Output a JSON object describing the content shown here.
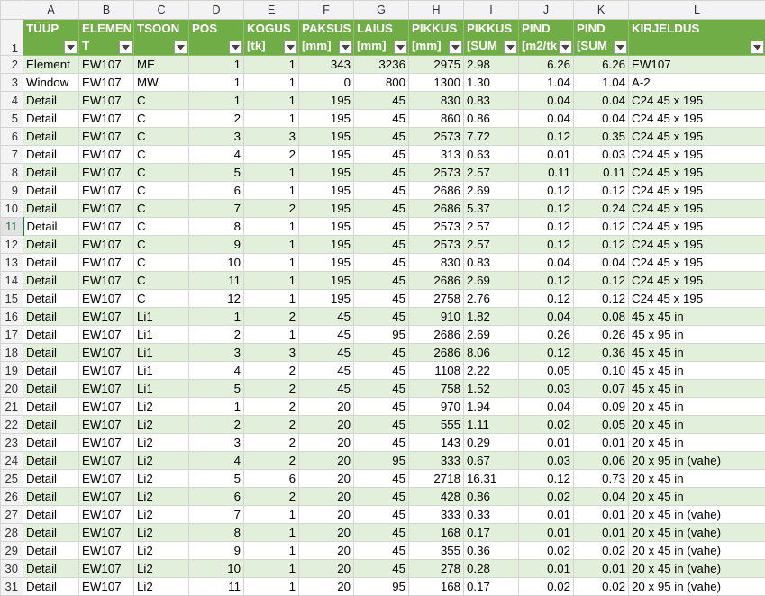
{
  "columns": [
    "A",
    "B",
    "C",
    "D",
    "E",
    "F",
    "G",
    "H",
    "I",
    "J",
    "K",
    "L"
  ],
  "header_row_number": "1",
  "headers": [
    {
      "l1": "TÜÜP",
      "l2": ""
    },
    {
      "l1": "ELEMEN",
      "l2": "T"
    },
    {
      "l1": "TSOON",
      "l2": ""
    },
    {
      "l1": "POS",
      "l2": ""
    },
    {
      "l1": "KOGUS",
      "l2": "[tk]"
    },
    {
      "l1": "PAKSUS",
      "l2": "[mm]"
    },
    {
      "l1": "LAIUS",
      "l2": "[mm]"
    },
    {
      "l1": "PIKKUS",
      "l2": "[mm]"
    },
    {
      "l1": "PIKKUS",
      "l2": "[SUM"
    },
    {
      "l1": "PIND",
      "l2": "[m2/tk"
    },
    {
      "l1": "PIND",
      "l2": "[SUM"
    },
    {
      "l1": "KIRJELDUS",
      "l2": ""
    }
  ],
  "filter_icon": "filter-dropdown-icon",
  "selected_row": "11",
  "rows": [
    {
      "n": "2",
      "c": [
        "Element",
        "EW107",
        "ME",
        "1",
        "1",
        "343",
        "3236",
        "2975",
        "2.98",
        "6.26",
        "6.26",
        "EW107"
      ]
    },
    {
      "n": "3",
      "c": [
        "Window",
        "EW107",
        "MW",
        "1",
        "1",
        "0",
        "800",
        "1300",
        "1.30",
        "1.04",
        "1.04",
        "A-2"
      ]
    },
    {
      "n": "4",
      "c": [
        "Detail",
        "EW107",
        "C",
        "1",
        "1",
        "195",
        "45",
        "830",
        "0.83",
        "0.04",
        "0.04",
        "C24 45 x 195"
      ]
    },
    {
      "n": "5",
      "c": [
        "Detail",
        "EW107",
        "C",
        "2",
        "1",
        "195",
        "45",
        "860",
        "0.86",
        "0.04",
        "0.04",
        "C24 45 x 195"
      ]
    },
    {
      "n": "6",
      "c": [
        "Detail",
        "EW107",
        "C",
        "3",
        "3",
        "195",
        "45",
        "2573",
        "7.72",
        "0.12",
        "0.35",
        "C24 45 x 195"
      ]
    },
    {
      "n": "7",
      "c": [
        "Detail",
        "EW107",
        "C",
        "4",
        "2",
        "195",
        "45",
        "313",
        "0.63",
        "0.01",
        "0.03",
        "C24 45 x 195"
      ]
    },
    {
      "n": "8",
      "c": [
        "Detail",
        "EW107",
        "C",
        "5",
        "1",
        "195",
        "45",
        "2573",
        "2.57",
        "0.11",
        "0.11",
        "C24 45 x 195"
      ]
    },
    {
      "n": "9",
      "c": [
        "Detail",
        "EW107",
        "C",
        "6",
        "1",
        "195",
        "45",
        "2686",
        "2.69",
        "0.12",
        "0.12",
        "C24 45 x 195"
      ]
    },
    {
      "n": "10",
      "c": [
        "Detail",
        "EW107",
        "C",
        "7",
        "2",
        "195",
        "45",
        "2686",
        "5.37",
        "0.12",
        "0.24",
        "C24 45 x 195"
      ]
    },
    {
      "n": "11",
      "c": [
        "Detail",
        "EW107",
        "C",
        "8",
        "1",
        "195",
        "45",
        "2573",
        "2.57",
        "0.12",
        "0.12",
        "C24 45 x 195"
      ]
    },
    {
      "n": "12",
      "c": [
        "Detail",
        "EW107",
        "C",
        "9",
        "1",
        "195",
        "45",
        "2573",
        "2.57",
        "0.12",
        "0.12",
        "C24 45 x 195"
      ]
    },
    {
      "n": "13",
      "c": [
        "Detail",
        "EW107",
        "C",
        "10",
        "1",
        "195",
        "45",
        "830",
        "0.83",
        "0.04",
        "0.04",
        "C24 45 x 195"
      ]
    },
    {
      "n": "14",
      "c": [
        "Detail",
        "EW107",
        "C",
        "11",
        "1",
        "195",
        "45",
        "2686",
        "2.69",
        "0.12",
        "0.12",
        "C24 45 x 195"
      ]
    },
    {
      "n": "15",
      "c": [
        "Detail",
        "EW107",
        "C",
        "12",
        "1",
        "195",
        "45",
        "2758",
        "2.76",
        "0.12",
        "0.12",
        "C24 45 x 195"
      ]
    },
    {
      "n": "16",
      "c": [
        "Detail",
        "EW107",
        "Li1",
        "1",
        "2",
        "45",
        "45",
        "910",
        "1.82",
        "0.04",
        "0.08",
        "45 x 45 in"
      ]
    },
    {
      "n": "17",
      "c": [
        "Detail",
        "EW107",
        "Li1",
        "2",
        "1",
        "45",
        "95",
        "2686",
        "2.69",
        "0.26",
        "0.26",
        "45 x 95 in"
      ]
    },
    {
      "n": "18",
      "c": [
        "Detail",
        "EW107",
        "Li1",
        "3",
        "3",
        "45",
        "45",
        "2686",
        "8.06",
        "0.12",
        "0.36",
        "45 x 45 in"
      ]
    },
    {
      "n": "19",
      "c": [
        "Detail",
        "EW107",
        "Li1",
        "4",
        "2",
        "45",
        "45",
        "1108",
        "2.22",
        "0.05",
        "0.10",
        "45 x 45 in"
      ]
    },
    {
      "n": "20",
      "c": [
        "Detail",
        "EW107",
        "Li1",
        "5",
        "2",
        "45",
        "45",
        "758",
        "1.52",
        "0.03",
        "0.07",
        "45 x 45 in"
      ]
    },
    {
      "n": "21",
      "c": [
        "Detail",
        "EW107",
        "Li2",
        "1",
        "2",
        "20",
        "45",
        "970",
        "1.94",
        "0.04",
        "0.09",
        "20 x 45 in"
      ]
    },
    {
      "n": "22",
      "c": [
        "Detail",
        "EW107",
        "Li2",
        "2",
        "2",
        "20",
        "45",
        "555",
        "1.11",
        "0.02",
        "0.05",
        "20 x 45 in"
      ]
    },
    {
      "n": "23",
      "c": [
        "Detail",
        "EW107",
        "Li2",
        "3",
        "2",
        "20",
        "45",
        "143",
        "0.29",
        "0.01",
        "0.01",
        "20 x 45 in"
      ]
    },
    {
      "n": "24",
      "c": [
        "Detail",
        "EW107",
        "Li2",
        "4",
        "2",
        "20",
        "95",
        "333",
        "0.67",
        "0.03",
        "0.06",
        "20 x 95 in (vahe)"
      ]
    },
    {
      "n": "25",
      "c": [
        "Detail",
        "EW107",
        "Li2",
        "5",
        "6",
        "20",
        "45",
        "2718",
        "16.31",
        "0.12",
        "0.73",
        "20 x 45 in"
      ]
    },
    {
      "n": "26",
      "c": [
        "Detail",
        "EW107",
        "Li2",
        "6",
        "2",
        "20",
        "45",
        "428",
        "0.86",
        "0.02",
        "0.04",
        "20 x 45 in"
      ]
    },
    {
      "n": "27",
      "c": [
        "Detail",
        "EW107",
        "Li2",
        "7",
        "1",
        "20",
        "45",
        "333",
        "0.33",
        "0.01",
        "0.01",
        "20 x 45 in (vahe)"
      ]
    },
    {
      "n": "28",
      "c": [
        "Detail",
        "EW107",
        "Li2",
        "8",
        "1",
        "20",
        "45",
        "168",
        "0.17",
        "0.01",
        "0.01",
        "20 x 45 in (vahe)"
      ]
    },
    {
      "n": "29",
      "c": [
        "Detail",
        "EW107",
        "Li2",
        "9",
        "1",
        "20",
        "45",
        "355",
        "0.36",
        "0.02",
        "0.02",
        "20 x 45 in (vahe)"
      ]
    },
    {
      "n": "30",
      "c": [
        "Detail",
        "EW107",
        "Li2",
        "10",
        "1",
        "20",
        "45",
        "278",
        "0.28",
        "0.01",
        "0.01",
        "20 x 45 in (vahe)"
      ]
    },
    {
      "n": "31",
      "c": [
        "Detail",
        "EW107",
        "Li2",
        "11",
        "1",
        "20",
        "95",
        "168",
        "0.17",
        "0.02",
        "0.02",
        "20 x 95 in (vahe)"
      ]
    }
  ],
  "colors": {
    "header_green": "#70ad47",
    "band_green": "#e2efda",
    "selection_green": "#217346"
  }
}
